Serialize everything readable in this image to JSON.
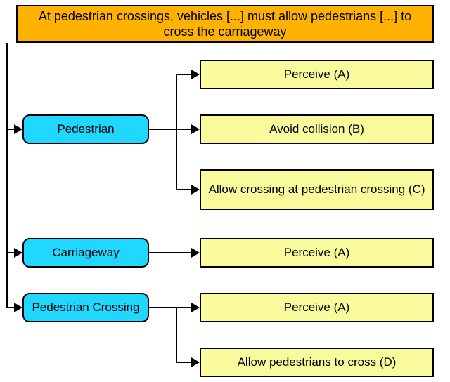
{
  "title": "At pedestrian crossings, vehicles [...] must allow pedestrians [...] to cross the carriageway",
  "entities": {
    "pedestrian": {
      "label": "Pedestrian",
      "leaves": [
        {
          "label": "Perceive (A)"
        },
        {
          "label": "Avoid collision (B)"
        },
        {
          "label": "Allow crossing at pedestrian crossing (C)"
        }
      ]
    },
    "carriageway": {
      "label": "Carriageway",
      "leaves": [
        {
          "label": "Perceive (A)"
        }
      ]
    },
    "pedestrian_crossing": {
      "label": "Pedestrian Crossing",
      "leaves": [
        {
          "label": "Perceive (A)"
        },
        {
          "label": "Allow pedestrians to cross (D)"
        }
      ]
    }
  }
}
